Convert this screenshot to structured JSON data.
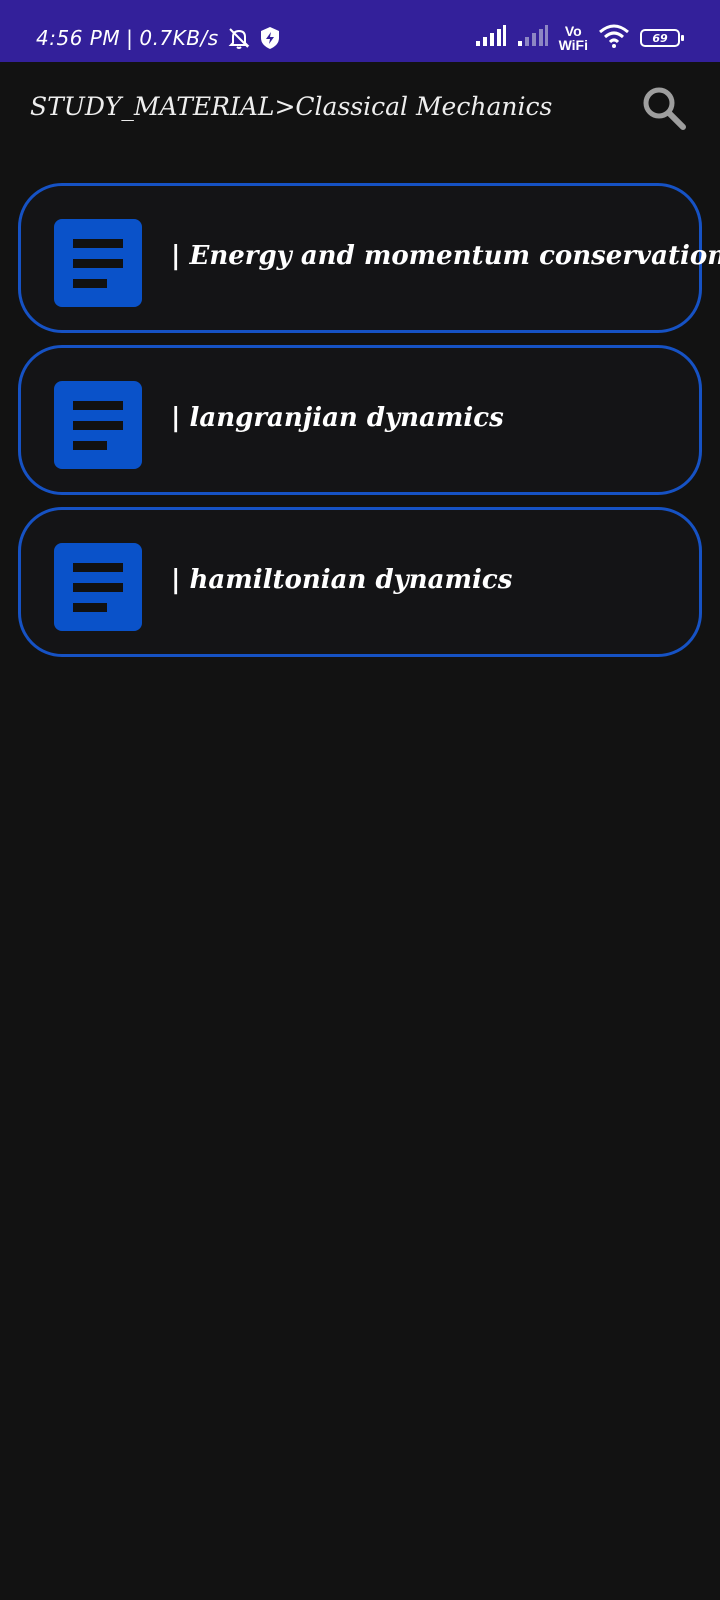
{
  "status_bar": {
    "time": "4:56 PM",
    "separator": "|",
    "net_speed": "0.7KB/s",
    "vowifi_top": "Vo",
    "vowifi_bottom": "WiFi",
    "battery": "69",
    "icons": [
      "muted-bell-icon",
      "shield-bolt-icon",
      "signal-icon",
      "signal-icon",
      "wifi-icon",
      "battery-icon"
    ]
  },
  "header": {
    "breadcrumb": "STUDY_MATERIAL>Classical Mechanics",
    "search_icon": "search-icon"
  },
  "items": [
    {
      "prefix": "|",
      "title": "Energy and momentum conservation",
      "icon": "document-icon"
    },
    {
      "prefix": "|",
      "title": "langranjian dynamics",
      "icon": "document-icon"
    },
    {
      "prefix": "|",
      "title": "hamiltonian dynamics",
      "icon": "document-icon"
    }
  ],
  "colors": {
    "status_bar_bg": "#33209a",
    "background": "#121212",
    "card_border": "#1652c4",
    "icon_bg": "#0a52c9",
    "text": "#ffffff"
  }
}
